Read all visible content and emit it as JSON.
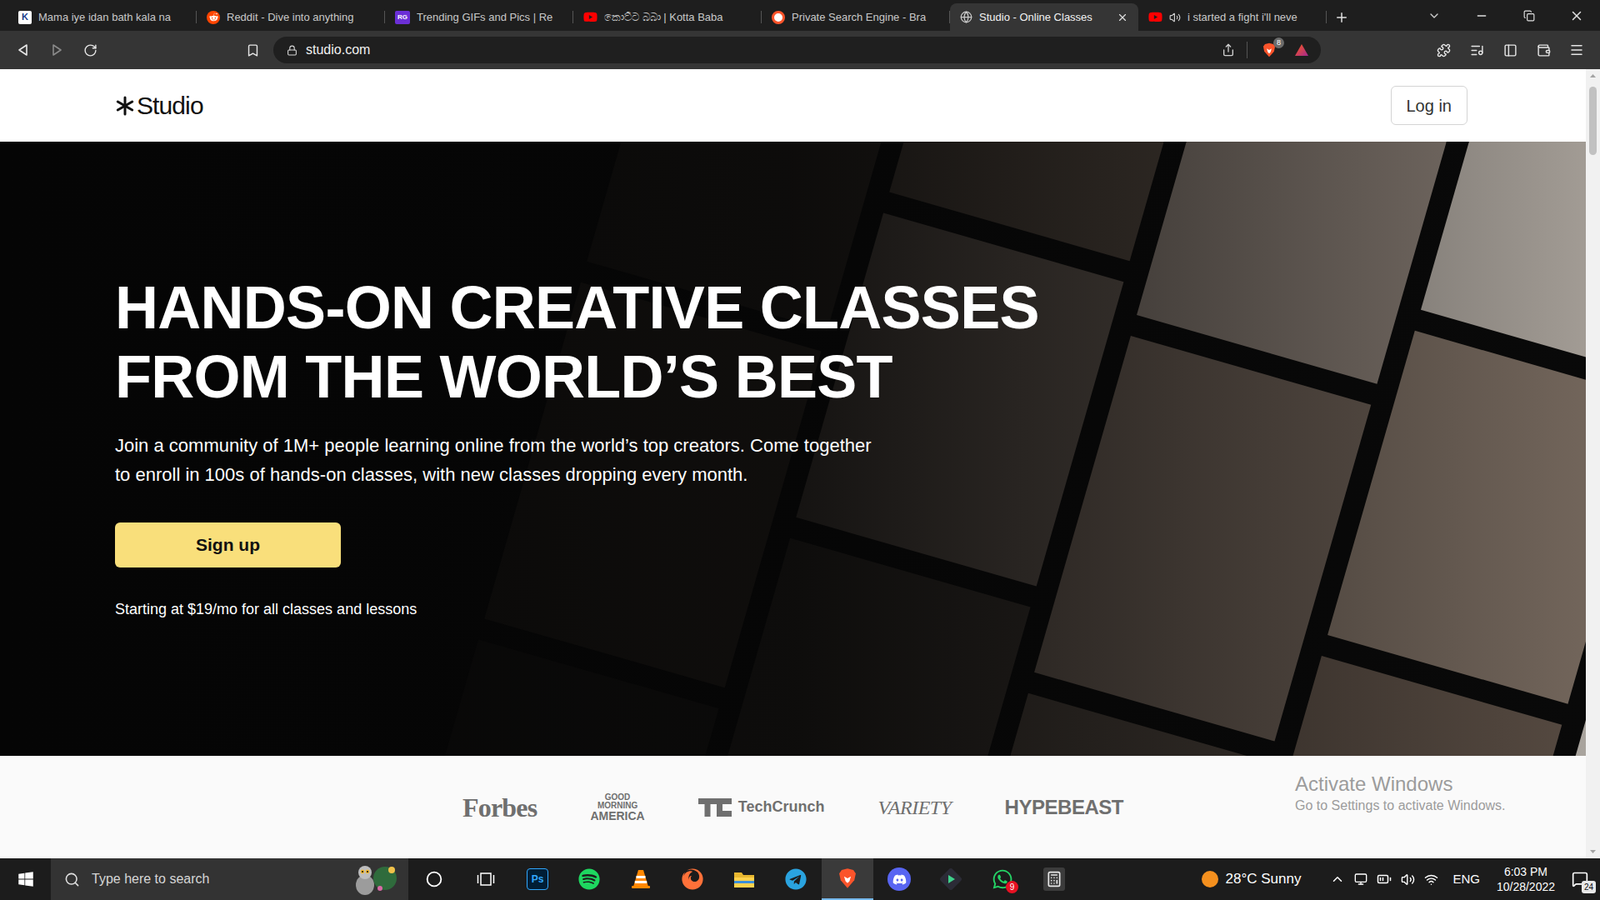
{
  "browser": {
    "tabs": [
      {
        "title": "Mama iye idan bath kala na",
        "favicon": "kotta",
        "favicon_text": "K",
        "selected": false,
        "playing": false
      },
      {
        "title": "Reddit - Dive into anything",
        "favicon": "reddit",
        "selected": false,
        "playing": false
      },
      {
        "title": "Trending GIFs and Pics | Re",
        "favicon": "rg",
        "favicon_text": "RG",
        "selected": false,
        "playing": false
      },
      {
        "title": "කොට්ට බබා | Kotta Baba",
        "favicon": "youtube",
        "selected": false,
        "playing": false
      },
      {
        "title": "Private Search Engine - Bra",
        "favicon": "brave-search",
        "selected": false,
        "playing": false
      },
      {
        "title": "Studio - Online Classes",
        "favicon": "globe",
        "selected": true,
        "playing": false
      },
      {
        "title": "i started a fight i'll neve",
        "favicon": "youtube",
        "selected": false,
        "playing": true
      }
    ],
    "url": "studio.com",
    "shield_badge": "8"
  },
  "page": {
    "header": {
      "logo": "Studio",
      "login_button": "Log in"
    },
    "hero": {
      "heading": [
        "HANDS-ON CREATIVE CLASSES",
        "FROM THE WORLD’S BEST"
      ],
      "text": "Join a community of 1M+ people learning online from the world’s top creators. Come together to enroll in 100s of hands-on classes, with new classes dropping every month.",
      "cta": "Sign up",
      "pricing": "Starting at $19/mo for all classes and lessons"
    },
    "press": [
      {
        "kind": "forbes",
        "text": "Forbes"
      },
      {
        "kind": "gma",
        "lines": [
          "GOOD",
          "MORNING",
          "AMERICA"
        ]
      },
      {
        "kind": "techcrunch",
        "text": "TechCrunch"
      },
      {
        "kind": "variety",
        "text": "VARIETY"
      },
      {
        "kind": "hypebeast",
        "text": "HYPEBEAST"
      }
    ]
  },
  "watermark": {
    "title": "Activate Windows",
    "subtitle": "Go to Settings to activate Windows."
  },
  "taskbar": {
    "search_placeholder": "Type here to search",
    "apps": [
      {
        "kind": "cortana",
        "selected": false
      },
      {
        "kind": "taskview",
        "selected": false
      },
      {
        "kind": "photoshop",
        "label": "Ps",
        "selected": false
      },
      {
        "kind": "spotify",
        "selected": false
      },
      {
        "kind": "vlc",
        "selected": false
      },
      {
        "kind": "firefox",
        "selected": false
      },
      {
        "kind": "explorer",
        "selected": false
      },
      {
        "kind": "telegram",
        "selected": false
      },
      {
        "kind": "brave",
        "selected": true
      },
      {
        "kind": "discord",
        "selected": false
      },
      {
        "kind": "stremio",
        "selected": false
      },
      {
        "kind": "whatsapp",
        "badge": "9",
        "selected": false
      },
      {
        "kind": "calculator",
        "selected": false
      }
    ],
    "weather": "28°C Sunny",
    "language": "ENG",
    "time": "6:03 PM",
    "date": "10/28/2022",
    "notifications": "24"
  }
}
